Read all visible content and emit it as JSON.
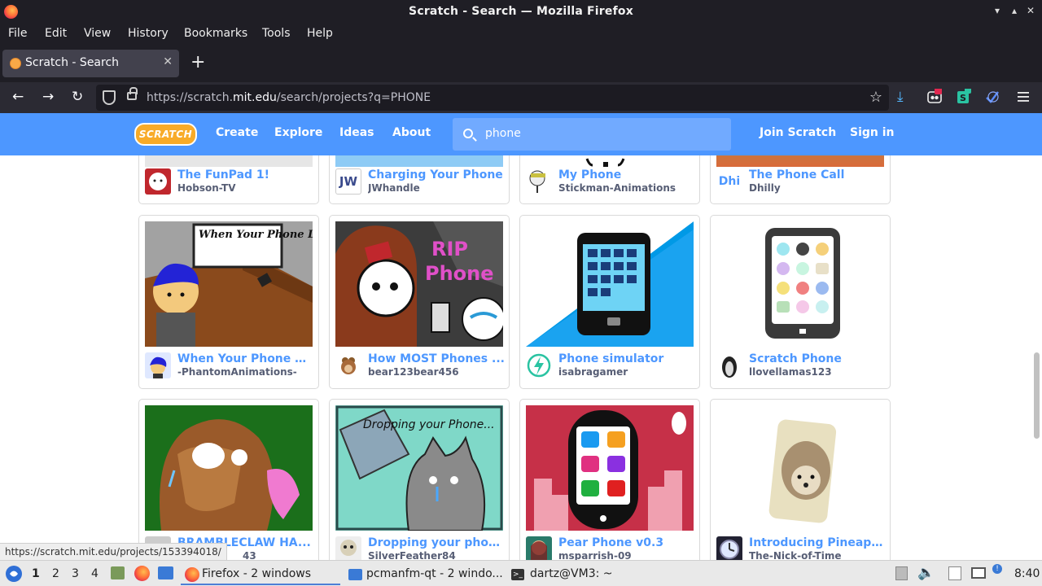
{
  "window": {
    "title": "Scratch - Search — Mozilla Firefox",
    "controls": [
      "▾",
      "▴",
      "✕"
    ]
  },
  "menu": [
    "File",
    "Edit",
    "View",
    "History",
    "Bookmarks",
    "Tools",
    "Help"
  ],
  "tab": {
    "title": "Scratch - Search",
    "close": "✕",
    "new_tab": "+"
  },
  "nav": {
    "url_prefix": "https://scratch.",
    "url_domain": "mit.edu",
    "url_suffix": "/search/projects?q=PHONE",
    "ublock_badge": "1",
    "ext_badge": "1"
  },
  "scratch": {
    "logo": "SCRATCH",
    "nav": [
      "Create",
      "Explore",
      "Ideas",
      "About"
    ],
    "search_value": "phone",
    "join": "Join Scratch",
    "signin": "Sign in"
  },
  "projects": [
    {
      "title": "The FunPad 1!",
      "author": "Hobson-TV"
    },
    {
      "title": "Charging Your Phone",
      "author": "JWhandle",
      "avatar_text": "JW"
    },
    {
      "title": "My Phone",
      "author": "Stickman-Animations"
    },
    {
      "title": "The Phone Call",
      "author": "Dhilly",
      "avatar_text": "Dhi"
    },
    {
      "title": "When Your Phone D...",
      "author": "-PhantomAnimations-",
      "thumb_text": "When Your Phone Doesn't Charge"
    },
    {
      "title": "How MOST Phones ...",
      "author": "bear123bear456",
      "thumb_text": "RIP Phone"
    },
    {
      "title": "Phone simulator",
      "author": "isabragamer"
    },
    {
      "title": "Scratch Phone",
      "author": "llovellamas123"
    },
    {
      "title": "BRAMBLECLAW HA...",
      "author": "43"
    },
    {
      "title": "Dropping your phon...",
      "author": "SilverFeather84",
      "thumb_text": "Dropping your Phone..."
    },
    {
      "title": "Pear Phone v0.3",
      "author": "msparrish-09"
    },
    {
      "title": "Introducing Pineappl...",
      "author": "The-Nick-of-Time"
    }
  ],
  "status_url": "https://scratch.mit.edu/projects/153394018/",
  "taskbar": {
    "workspaces": [
      "1",
      "2",
      "3",
      "4"
    ],
    "tasks": [
      "Firefox - 2 windows",
      "pcmanfm-qt - 2 windo...",
      "dartz@VM3: ~"
    ],
    "clock": "8:40"
  }
}
